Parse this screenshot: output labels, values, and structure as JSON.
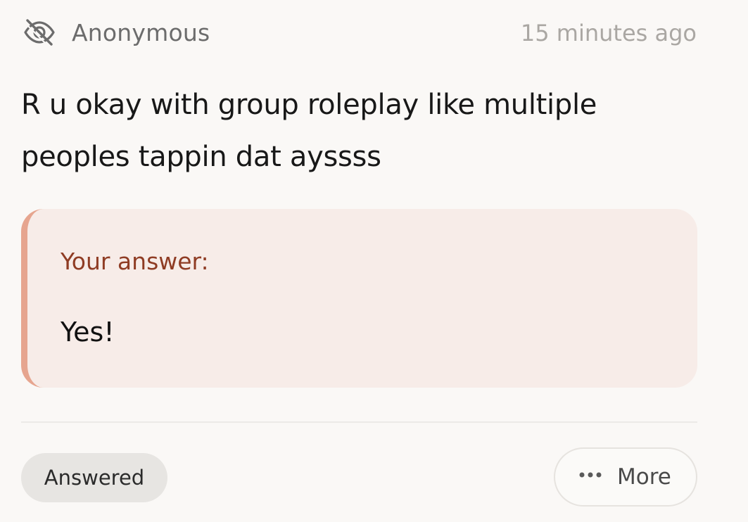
{
  "question_card": {
    "author": "Anonymous",
    "timestamp": "15 minutes ago",
    "question": "R u okay with group roleplay like multiple peoples tappin dat ayssss",
    "answer": {
      "label": "Your answer:",
      "text": "Yes!"
    },
    "status": "Answered",
    "more_label": "More",
    "icons": {
      "anonymous": "eye-off-icon",
      "more": "more-horizontal-icon"
    },
    "colors": {
      "accent": "#e6a58f",
      "answer_background": "#f7ece8",
      "answer_label": "#8f3c24"
    }
  }
}
